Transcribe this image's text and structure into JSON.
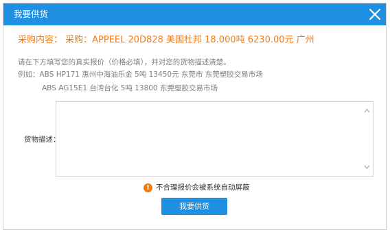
{
  "dialog": {
    "title": "我要供货",
    "close_icon": "close-icon"
  },
  "purchase": {
    "text": "采购内容： 采购：APPEEL 20D828 美国杜邦 18.000吨 6230.00元 广州"
  },
  "hints": {
    "line1": "请在下方填写您的真实报价（价格必填），并对您的货物描述清楚。",
    "line2": "例如：ABS HP171 惠州中海油乐金 5吨 13450元 东莞市 东莞塑胶交易市场",
    "line3": "ABS AG15E1 台湾台化 5吨 13800 东莞塑胶交易市场"
  },
  "description": {
    "label": "货物描述：",
    "value": ""
  },
  "warning": {
    "icon": "warning-icon",
    "text": "不合理报价会被系统自动屏蔽"
  },
  "submit": {
    "label": "我要供货"
  },
  "colors": {
    "primary": "#1e8fe1",
    "accent": "#f07b14",
    "hint": "#7d7d7d"
  }
}
